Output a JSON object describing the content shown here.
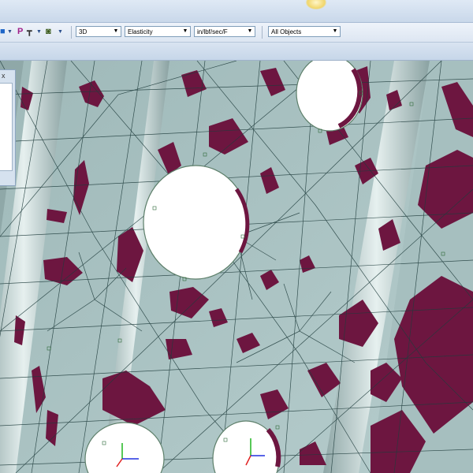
{
  "toolbar": {
    "view_mode": "3D",
    "analysis_property": "Elasticity",
    "units": "in/lbf/sec/F",
    "object_filter": "All Objects",
    "icon_labels": {
      "probe": "P"
    }
  },
  "panel": {
    "close_glyph": "x"
  },
  "colors": {
    "mesh_surface": "#a9c3c3",
    "stress_spots": "#6d1640",
    "mesh_lines": "#1f3c3c",
    "holes": "#ffffff",
    "toolbar_bg": "#e4ebf5"
  },
  "icons": [
    "selection-icon",
    "probe-icon",
    "tree-icon",
    "camera-icon",
    "triad-icon"
  ]
}
